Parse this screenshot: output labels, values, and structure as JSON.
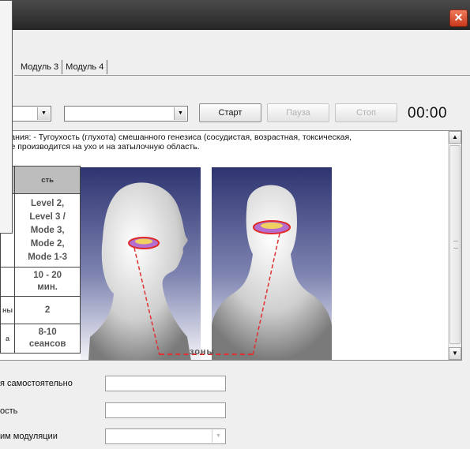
{
  "window": {
    "close_glyph": "✕"
  },
  "tabs": [
    "Модуль 3",
    "Модуль 4"
  ],
  "controls": {
    "combo1_value": "",
    "combo2_value": "",
    "start_label": "Старт",
    "pause_label": "Пауза",
    "stop_label": "Стоп",
    "timer": "00:00"
  },
  "description": {
    "line1": "евания: - Тугоухость (глухота) смешанного генезиса (сосудистая, возрастная, токсическая,",
    "line2": "вие производится на ухо и на затылочную область."
  },
  "table": {
    "header": "сть",
    "cells": [
      {
        "left": "",
        "right": "Level 2,\nLevel 3 /\nMode 3,\nMode 2,\nMode 1-3"
      },
      {
        "left": "",
        "right": "10 - 20\nмин."
      },
      {
        "left": "ны",
        "right": "2"
      },
      {
        "left": "а",
        "right": "8-10\nсеансов"
      }
    ]
  },
  "illustration": {
    "zones_label": "зоны"
  },
  "form": {
    "label1": "я самостоятельно",
    "label2": "ость",
    "label3": "им модуляции",
    "field1_value": "",
    "field2_value": "",
    "field3_value": ""
  },
  "colors": {
    "title_bar": "#333333",
    "close": "#e05030",
    "photo_bg": "#3a3f7a",
    "zone_line": "#e03030"
  }
}
